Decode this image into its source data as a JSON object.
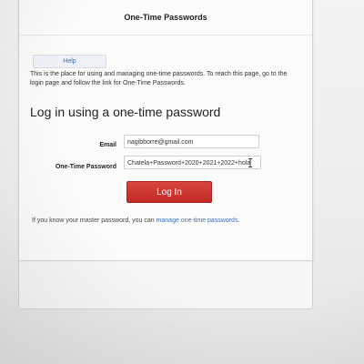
{
  "page": {
    "title": "One-Time Passwords"
  },
  "help": {
    "label": "Help"
  },
  "intro": {
    "text": "This is the place for using and managing one-time passwords. To reach this page, go to the login page and follow the link for One-Time Passwords."
  },
  "login_form": {
    "heading": "Log in using a one-time password",
    "email_label": "Email",
    "email_value": "nagibborre@gmail.com",
    "otp_label": "One-Time Password",
    "otp_value": "Chatela+Password+2020+2021+2022+hola",
    "submit_label": "Log In"
  },
  "footer": {
    "prefix": "If you know your master password, you can ",
    "link_text": "manage one-time passwords",
    "suffix": "."
  },
  "colors": {
    "login_button": "#c9302c",
    "link": "#3f6fb0"
  },
  "icons": {
    "text_cursor": "i-beam-cursor-icon"
  }
}
